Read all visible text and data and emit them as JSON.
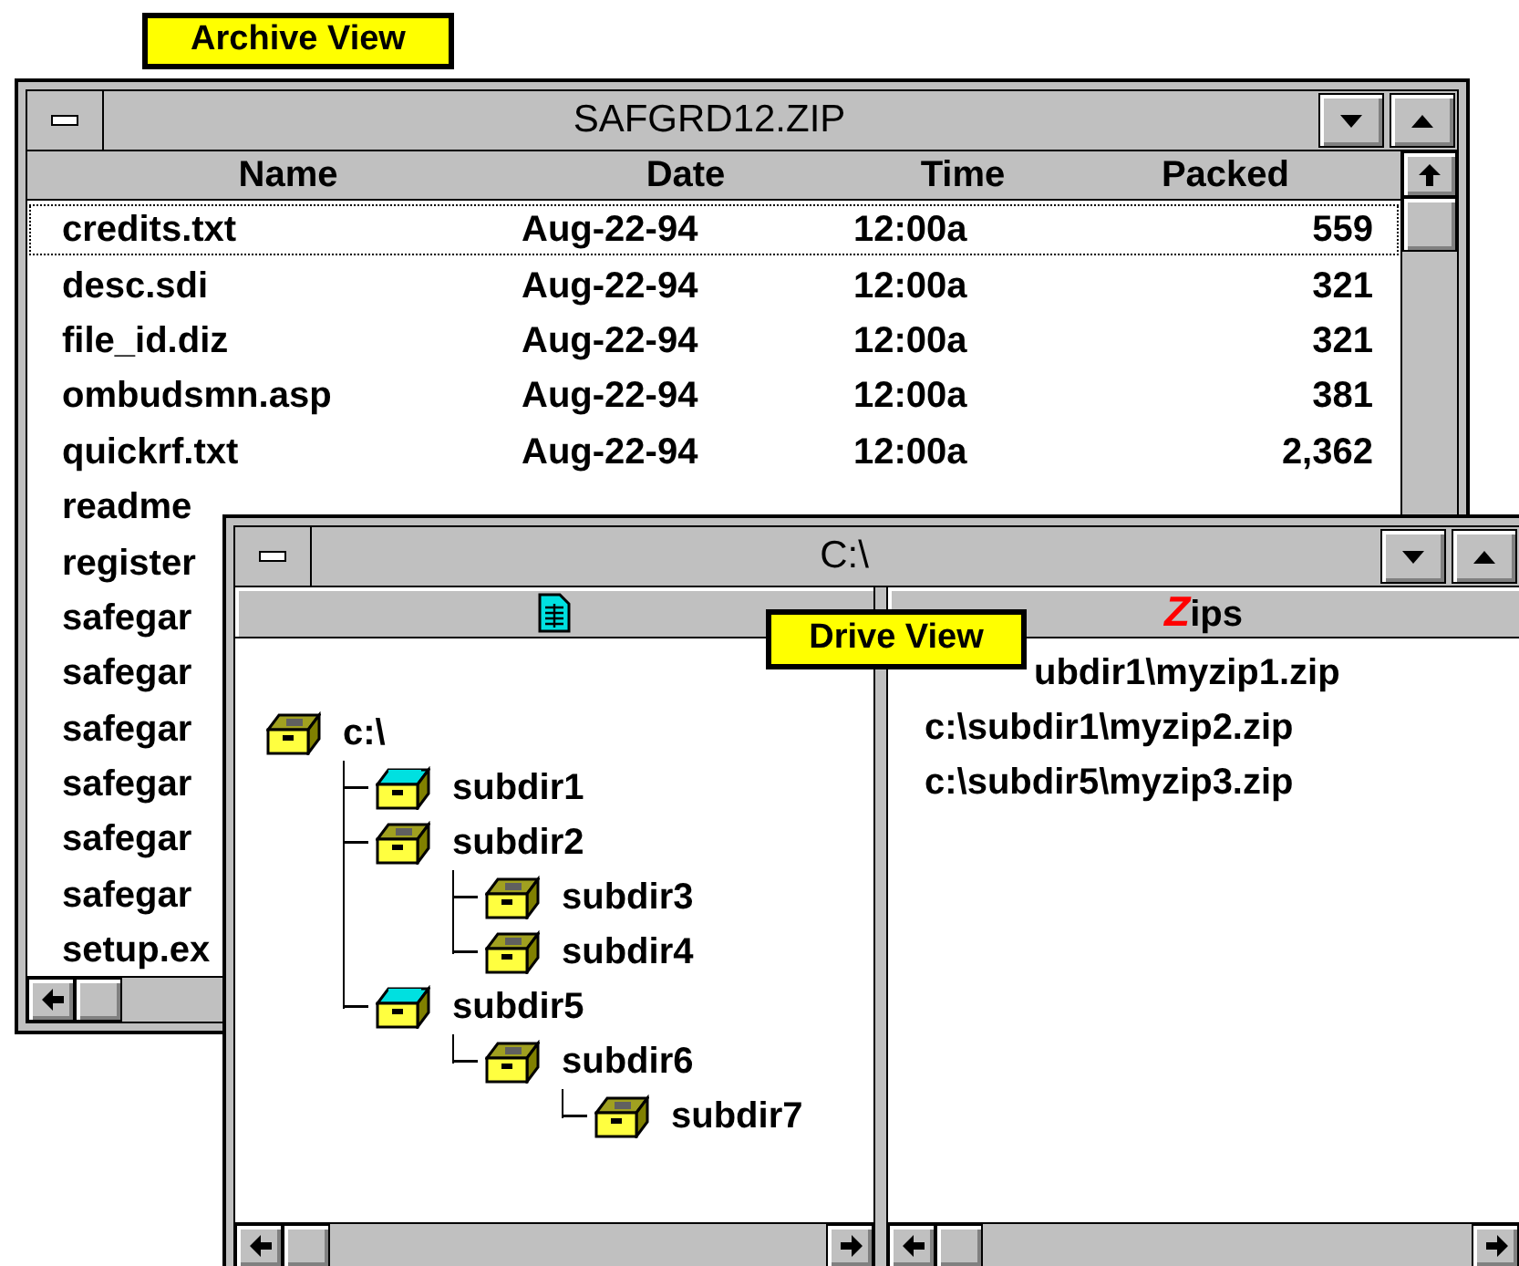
{
  "archive_window": {
    "label": "Archive View",
    "title": "SAFGRD12.ZIP",
    "columns": [
      "Name",
      "Date",
      "Time",
      "Packed"
    ],
    "rows": [
      {
        "name": "credits.txt",
        "date": "Aug-22-94",
        "time": "12:00a",
        "packed": "559",
        "focused": true
      },
      {
        "name": "desc.sdi",
        "date": "Aug-22-94",
        "time": "12:00a",
        "packed": "321",
        "focused": false
      },
      {
        "name": "file_id.diz",
        "date": "Aug-22-94",
        "time": "12:00a",
        "packed": "321",
        "focused": false
      },
      {
        "name": "ombudsmn.asp",
        "date": "Aug-22-94",
        "time": "12:00a",
        "packed": "381",
        "focused": false
      },
      {
        "name": "quickrf.txt",
        "date": "Aug-22-94",
        "time": "12:00a",
        "packed": "2,362",
        "focused": false
      },
      {
        "name": "readme",
        "focused": false
      },
      {
        "name": "register",
        "focused": false
      },
      {
        "name": "safegar",
        "focused": false
      },
      {
        "name": "safegar",
        "focused": false
      },
      {
        "name": "safegar",
        "focused": false
      },
      {
        "name": "safegar",
        "focused": false
      },
      {
        "name": "safegar",
        "focused": false
      },
      {
        "name": "safegar",
        "focused": false
      },
      {
        "name": "setup.ex",
        "focused": false
      }
    ]
  },
  "drive_window": {
    "label": "Drive View",
    "title": "C:\\",
    "zips_header": "Zips",
    "tree": {
      "name": "c:\\",
      "kind": "plain",
      "children": [
        {
          "name": "subdir1",
          "kind": "zips"
        },
        {
          "name": "subdir2",
          "kind": "plain",
          "children": [
            {
              "name": "subdir3",
              "kind": "plain"
            },
            {
              "name": "subdir4",
              "kind": "plain"
            }
          ]
        },
        {
          "name": "subdir5",
          "kind": "zips",
          "children": [
            {
              "name": "subdir6",
              "kind": "plain",
              "children": [
                {
                  "name": "subdir7",
                  "kind": "plain"
                }
              ]
            }
          ]
        }
      ]
    },
    "zip_files": [
      {
        "path": "ubdir1\\myzip1.zip",
        "covered": true
      },
      {
        "path": "c:\\subdir1\\myzip2.zip",
        "covered": false
      },
      {
        "path": "c:\\subdir5\\myzip3.zip",
        "covered": false
      }
    ]
  }
}
